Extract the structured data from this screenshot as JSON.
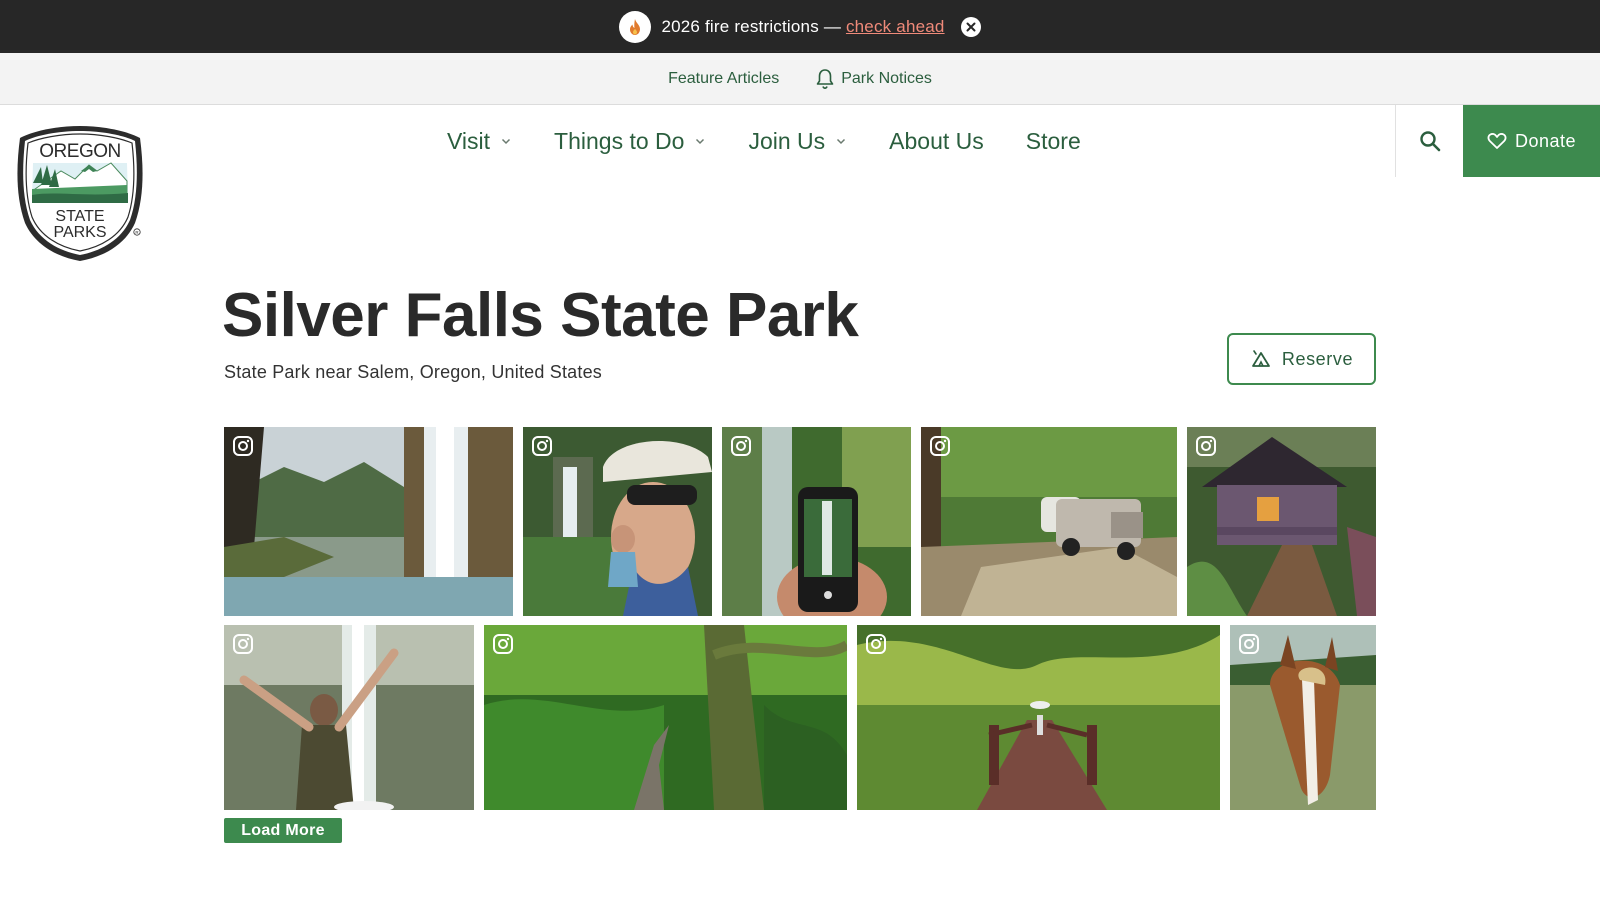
{
  "alert": {
    "text": "2026 fire restrictions — ",
    "link_label": "check ahead",
    "icon": "flame-icon"
  },
  "utility_nav": {
    "feature_articles": "Feature Articles",
    "park_notices": "Park Notices"
  },
  "main_nav": {
    "items": [
      {
        "label": "Visit",
        "has_dropdown": true
      },
      {
        "label": "Things to Do",
        "has_dropdown": true
      },
      {
        "label": "Join Us",
        "has_dropdown": true
      },
      {
        "label": "About Us",
        "has_dropdown": false
      },
      {
        "label": "Store",
        "has_dropdown": false
      }
    ],
    "donate_label": "Donate"
  },
  "logo": {
    "line1": "OREGON",
    "line2": "STATE",
    "line3": "PARKS"
  },
  "page": {
    "title": "Silver Falls State Park",
    "subtitle": "State Park near Salem, Oregon, United States",
    "reserve_label": "Reserve"
  },
  "gallery": {
    "photos": [
      {
        "subject": "waterfall-behind-cave"
      },
      {
        "subject": "hiker-selfie-with-waterfall"
      },
      {
        "subject": "phone-photographing-waterfall"
      },
      {
        "subject": "truck-and-trailer-campsite"
      },
      {
        "subject": "forest-cabin"
      },
      {
        "subject": "woman-arms-raised-at-waterfall"
      },
      {
        "subject": "forest-trail"
      },
      {
        "subject": "wooden-bridge-with-umbrella"
      },
      {
        "subject": "horse-in-pasture"
      }
    ],
    "load_more_label": "Load More"
  },
  "colors": {
    "brand_green": "#3d8a4e",
    "nav_text": "#2b5e3e",
    "alert_bg": "#272727",
    "alert_link": "#f08a7a"
  }
}
